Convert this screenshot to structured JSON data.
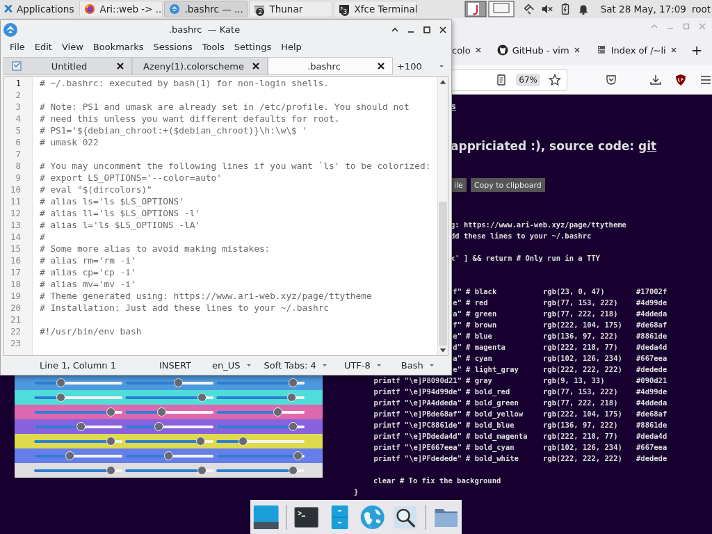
{
  "panel": {
    "apps_label": "Applications",
    "tasks": [
      {
        "label": "Ari::web -> ...",
        "kind": "firefox",
        "selected": false
      },
      {
        "label": ".bashrc  — ...",
        "kind": "kate",
        "selected": true
      },
      {
        "label": "Thunar",
        "kind": "files",
        "badge": "2",
        "selected": false
      },
      {
        "label": "Xfce Terminal",
        "kind": "terminal",
        "badge": "3",
        "selected": false
      }
    ],
    "clock": "Sat 28 May, 17:09",
    "user": "root"
  },
  "browser": {
    "tabs": [
      {
        "label": "colo",
        "kind": "plain",
        "selected": false
      },
      {
        "label": "GitHub - vim",
        "kind": "github",
        "selected": false
      },
      {
        "label": "Index of /~li",
        "kind": "index",
        "selected": false
      }
    ],
    "new_tab": "+",
    "zoom": "67%",
    "page": {
      "link_fragment": "s",
      "heading": "appriciated :), source code: ",
      "heading_link": "git",
      "buttons": [
        "ile",
        "Copy to clipboard"
      ],
      "intro_lines": [
        "g: https://www.ari-web.xyz/page/ttytheme",
        "dd these lines to your ~/.bashrc"
      ],
      "guard_line": "x' ] && return # Only run in a TTY",
      "swatches": [
        {
          "color": "#4d99de",
          "sliders": [
            {
              "level": 0.3
            },
            {
              "level": 0.6
            },
            {
              "level": 0.87
            }
          ]
        },
        {
          "color": "#4ddeda",
          "sliders": [
            {
              "level": 0.3
            },
            {
              "level": 0.87
            },
            {
              "level": 0.85
            }
          ]
        },
        {
          "color": "#de68af",
          "sliders": [
            {
              "level": 0.87
            },
            {
              "level": 0.41
            },
            {
              "level": 0.69
            }
          ]
        },
        {
          "color": "#8861de",
          "sliders": [
            {
              "level": 0.53
            },
            {
              "level": 0.38
            },
            {
              "level": 0.87
            }
          ]
        },
        {
          "color": "#deda4d",
          "sliders": [
            {
              "level": 0.87
            },
            {
              "level": 0.85
            },
            {
              "level": 0.3
            }
          ]
        },
        {
          "color": "#667eea",
          "sliders": [
            {
              "level": 0.4
            },
            {
              "level": 0.49
            },
            {
              "level": 0.92
            }
          ]
        },
        {
          "color": "#dedede",
          "sliders": [
            {
              "level": 0.87
            },
            {
              "level": 0.87
            },
            {
              "level": 0.87
            }
          ]
        }
      ],
      "theme_lines": [
        {
          "command": "f\"",
          "comment": "# black",
          "rgb": "rgb(23, 0, 47)",
          "hex": "#17002f"
        },
        {
          "command": "e\"",
          "comment": "# red",
          "rgb": "rgb(77, 153, 222)",
          "hex": "#4d99de"
        },
        {
          "command": "a\"",
          "comment": "# green",
          "rgb": "rgb(77, 222, 218)",
          "hex": "#4ddeda"
        },
        {
          "command": "f\"",
          "comment": "# brown",
          "rgb": "rgb(222, 104, 175)",
          "hex": "#de68af"
        },
        {
          "command": "e\"",
          "comment": "# blue",
          "rgb": "rgb(136, 97, 222)",
          "hex": "#8861de"
        },
        {
          "command": "d\"",
          "comment": "# magenta",
          "rgb": "rgb(222, 218, 77)",
          "hex": "#deda4d"
        },
        {
          "command": "a\"",
          "comment": "# cyan",
          "rgb": "rgb(102, 126, 234)",
          "hex": "#667eea"
        },
        {
          "command": "e\"",
          "comment": "# light_gray",
          "rgb": "rgb(222, 222, 222)",
          "hex": "#dedede"
        },
        {
          "command": "printf \"\\e]P8090d21\"",
          "comment": "# gray",
          "rgb": "rgb(9, 13, 33)",
          "hex": "#090d21"
        },
        {
          "command": "printf \"\\e]P94d99de\"",
          "comment": "# bold_red",
          "rgb": "rgb(77, 153, 222)",
          "hex": "#4d99de"
        },
        {
          "command": "printf \"\\e]PA4ddeda\"",
          "comment": "# bold_green",
          "rgb": "rgb(77, 222, 218)",
          "hex": "#4ddeda"
        },
        {
          "command": "printf \"\\e]PBde68af\"",
          "comment": "# bold_yellow",
          "rgb": "rgb(222, 104, 175)",
          "hex": "#de68af"
        },
        {
          "command": "printf \"\\e]PC8861de\"",
          "comment": "# bold_blue",
          "rgb": "rgb(136, 97, 222)",
          "hex": "#8861de"
        },
        {
          "command": "printf \"\\e]PDdeda4d\"",
          "comment": "# bold_magenta",
          "rgb": "rgb(222, 218, 77)",
          "hex": "#deda4d"
        },
        {
          "command": "printf \"\\e]PE667eea\"",
          "comment": "# bold_cyan",
          "rgb": "rgb(102, 126, 234)",
          "hex": "#667eea"
        },
        {
          "command": "printf \"\\e]PFdedede\"",
          "comment": "# bold_white",
          "rgb": "rgb(222, 222, 222)",
          "hex": "#dedede"
        }
      ],
      "footer_lines": [
        {
          "text": "clear # To fix the background",
          "kind": "body"
        },
        {
          "text": "}",
          "kind": "close"
        }
      ]
    }
  },
  "kate": {
    "title": ".bashrc  — Kate",
    "menu": [
      "File",
      "Edit",
      "View",
      "Bookmarks",
      "Sessions",
      "Tools",
      "Settings",
      "Help"
    ],
    "tabs": [
      {
        "label": "Untitled",
        "kind": "document",
        "selected": false
      },
      {
        "label": "Azeny(1).colorscheme",
        "kind": "plain",
        "selected": false
      },
      {
        "label": ".bashrc",
        "kind": "plain",
        "selected": true
      }
    ],
    "more_tabs": "+100",
    "lines": [
      {
        "number": "1",
        "text": "# ~/.bashrc: executed by bash(1) for non-login shells."
      },
      {
        "number": "2"
      },
      {
        "number": "3",
        "text": "# Note: PS1 and umask are already set in /etc/profile. You should not"
      },
      {
        "number": "4",
        "text": "# need this unless you want different defaults for root."
      },
      {
        "number": "5",
        "text": "# PS1='${debian_chroot:+($debian_chroot)}\\h:\\w\\$ '"
      },
      {
        "number": "6",
        "text": "# umask 022"
      },
      {
        "number": "7"
      },
      {
        "number": "8",
        "text": "# You may uncomment the following lines if you want `ls' to be colorized:"
      },
      {
        "number": "9",
        "text": "# export LS_OPTIONS='--color=auto'"
      },
      {
        "number": "10",
        "text": "# eval \"$(dircolors)\""
      },
      {
        "number": "11",
        "text": "# alias ls='ls $LS_OPTIONS'"
      },
      {
        "number": "12",
        "text": "# alias ll='ls $LS_OPTIONS -l'"
      },
      {
        "number": "13",
        "text": "# alias l='ls $LS_OPTIONS -lA'"
      },
      {
        "number": "14",
        "text": "#"
      },
      {
        "number": "15",
        "text": "# Some more alias to avoid making mistakes:"
      },
      {
        "number": "16",
        "text": "# alias rm='rm -i'"
      },
      {
        "number": "17",
        "text": "# alias cp='cp -i'"
      },
      {
        "number": "18",
        "text": "# alias mv='mv -i'"
      },
      {
        "number": "19",
        "text": "# Theme generated using: https://www.ari-web.xyz/page/ttytheme"
      },
      {
        "number": "20",
        "text": "# Installation: Just add these lines to your ~/.bashrc"
      },
      {
        "number": "21"
      },
      {
        "number": "22",
        "text": "#!/usr/bin/env bash"
      },
      {
        "number": "23"
      }
    ],
    "status": [
      {
        "label": "Line 1, Column 1",
        "dropdown": false
      },
      {
        "label": "INSERT",
        "dropdown": false
      },
      {
        "label": "en_US",
        "dropdown": true
      },
      {
        "label": "Soft Tabs: 4",
        "dropdown": true
      },
      {
        "label": "UTF-8",
        "dropdown": true
      },
      {
        "label": "Bash",
        "dropdown": true
      }
    ]
  }
}
